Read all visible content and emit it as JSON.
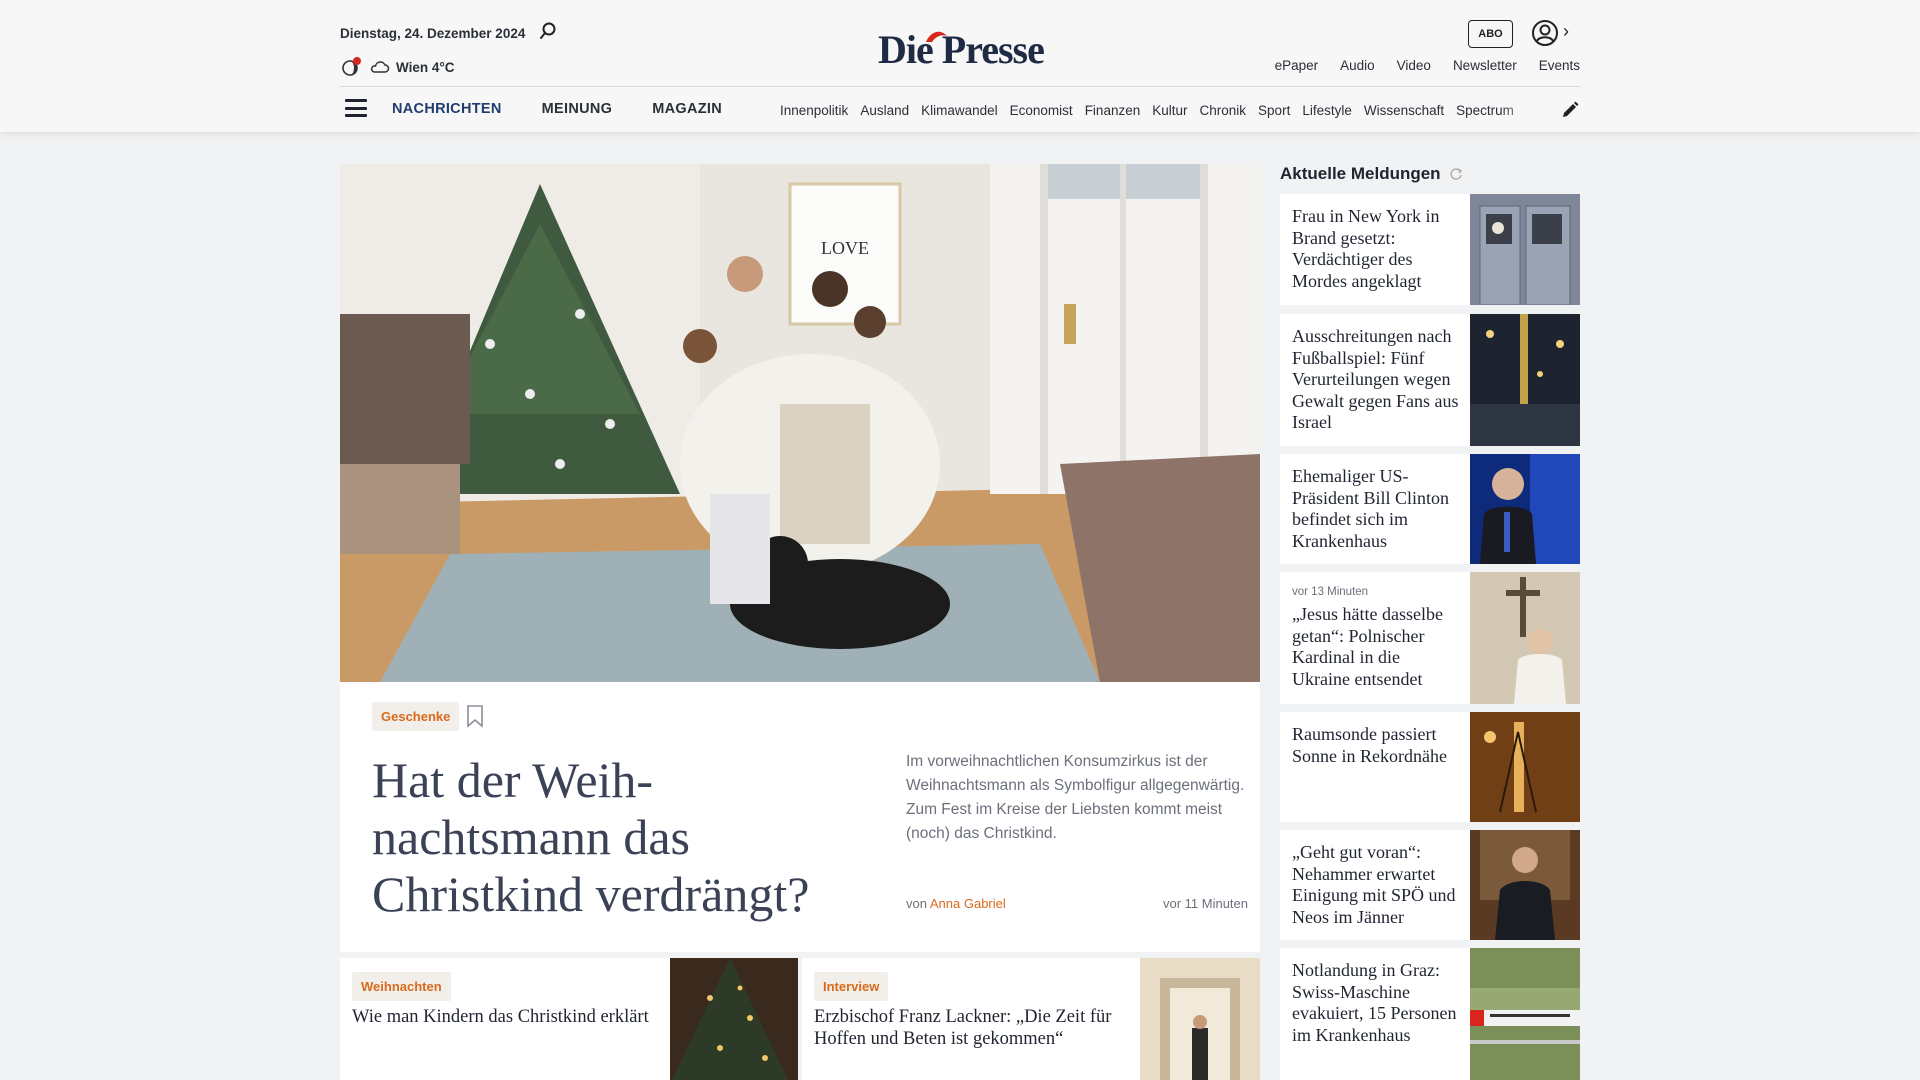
{
  "header": {
    "date": "Dienstag, 24. Dezember 2024",
    "weather": "Wien 4°C",
    "logo": "Die Presse",
    "abo_label": "ABO",
    "top_links": [
      "ePaper",
      "Audio",
      "Video",
      "Newsletter",
      "Events"
    ],
    "main_nav": [
      "NACHRICHTEN",
      "MEINUNG",
      "MAGAZIN"
    ],
    "categories": [
      "Innenpolitik",
      "Ausland",
      "Klimawandel",
      "Economist",
      "Finanzen",
      "Kultur",
      "Chronik",
      "Sport",
      "Lifestyle",
      "Wissenschaft",
      "Spectrum"
    ]
  },
  "hero": {
    "tag": "Geschenke",
    "title": "Hat der Weih-nachtsmann das Christkind verdrängt?",
    "teaser": "Im vorweihnachtlichen Konsumzirkus ist der Weihnachtsmann als Symbolfigur allgegenwärtig. Zum Fest im Kreise der Liebsten kommt meist (noch) das Christkind.",
    "byline_prefix": "von",
    "author": "Anna Gabriel",
    "time": "vor 11 Minuten",
    "image_label": "LOVE"
  },
  "cards": [
    {
      "tag": "Weihnachten",
      "title": "Wie man Kindern das Christkind erklärt"
    },
    {
      "tag": "Interview",
      "title": "Erzbischof Franz Lackner: „Die Zeit für Hoffen und Beten ist gekommen“"
    }
  ],
  "sidebar": {
    "heading": "Aktuelle Meldungen",
    "items": [
      {
        "time": "",
        "title": "Frau in New York in Brand gesetzt: Verdächtiger des Mordes angeklagt"
      },
      {
        "time": "",
        "title": "Ausschreitungen nach Fußballspiel: Fünf Verurteilungen wegen Gewalt gegen Fans aus Israel"
      },
      {
        "time": "",
        "title": "Ehemaliger US-Präsident Bill Clinton befindet sich im Krankenhaus"
      },
      {
        "time": "vor 13 Minuten",
        "title": "„Jesus hätte dasselbe getan“: Polnischer Kardinal in die Ukraine entsendet"
      },
      {
        "time": "",
        "title": "Raumsonde passiert Sonne in Rekordnähe"
      },
      {
        "time": "",
        "title": "„Geht gut voran“: Nehammer erwartet Einigung mit SPÖ und Neos im Jänner"
      },
      {
        "time": "",
        "title": "Notlandung in Graz: Swiss-Maschine evakuiert, 15 Personen im Krankenhaus"
      }
    ]
  },
  "colors": {
    "accent": "#d96a1c",
    "nav_active": "#1f3d6e",
    "logo_hat": "#d9261c"
  }
}
